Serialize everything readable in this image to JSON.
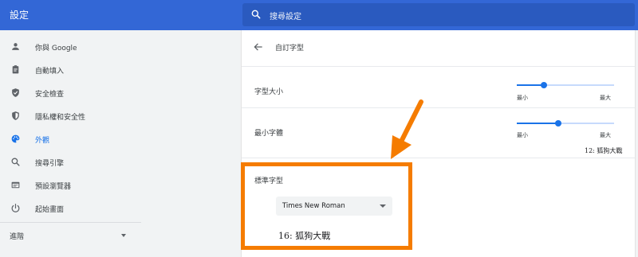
{
  "app": {
    "title": "設定"
  },
  "search": {
    "placeholder": "搜尋設定"
  },
  "sidebar": {
    "items": [
      {
        "label": "你與 Google",
        "icon": "person-icon"
      },
      {
        "label": "自動填入",
        "icon": "clipboard-icon"
      },
      {
        "label": "安全檢查",
        "icon": "shield-check-icon"
      },
      {
        "label": "隱私權和安全性",
        "icon": "shield-privacy-icon"
      },
      {
        "label": "外觀",
        "icon": "palette-icon",
        "active": true
      },
      {
        "label": "搜尋引擎",
        "icon": "search-icon"
      },
      {
        "label": "預設瀏覽器",
        "icon": "browser-icon"
      },
      {
        "label": "起始畫面",
        "icon": "power-icon"
      }
    ],
    "advanced_label": "進階"
  },
  "main": {
    "title": "自訂字型",
    "font_size": {
      "label": "字型大小",
      "min_label": "最小",
      "max_label": "最大",
      "value": 0.28
    },
    "min_font": {
      "label": "最小字體",
      "min_label": "最小",
      "max_label": "最大",
      "value": 0.43,
      "sample": "12: 狐狗大戰"
    },
    "standard_font": {
      "label": "標準字型",
      "selected": "Times New Roman",
      "sample": "16: 狐狗大戰"
    }
  },
  "colors": {
    "header_blue": "#3367d6",
    "accent_blue": "#1a73e8",
    "annotation_orange": "#f57c00",
    "background": "#f1f3f4"
  }
}
